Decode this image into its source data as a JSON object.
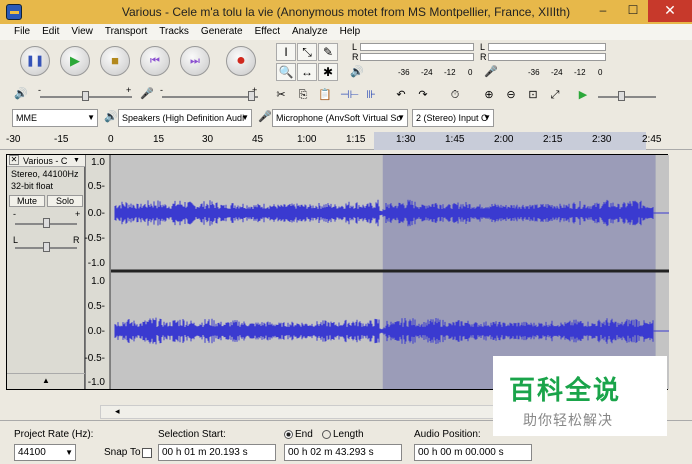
{
  "window": {
    "title": "Various - Cele m'a tolu la vie (Anonymous motet from MS Montpellier, France, XIIIth)",
    "min": "–",
    "max": "☐",
    "close": "✕"
  },
  "menu": [
    "File",
    "Edit",
    "View",
    "Transport",
    "Tracks",
    "Generate",
    "Effect",
    "Analyze",
    "Help"
  ],
  "transport": {
    "pause": "❚❚",
    "play": "▶",
    "stop": "■",
    "skip_start": "⏮",
    "skip_end": "⏭",
    "record": "●"
  },
  "tools": [
    "I",
    "⤡",
    "✎",
    "🔍",
    "↔",
    "✱"
  ],
  "meters": {
    "play_ticks": [
      "-36",
      "-24",
      "-12",
      "0"
    ],
    "rec_ticks": [
      "-36",
      "-24",
      "-12",
      "0"
    ],
    "L": "L",
    "R": "R"
  },
  "mixer": {
    "minus": "-",
    "plus": "+"
  },
  "devices": {
    "host": "MME",
    "output": "Speakers (High Definition Audi",
    "input": "Microphone (AnvSoft Virtual So",
    "channels": "2 (Stereo) Input C"
  },
  "timeline": {
    "ticks": [
      "-30",
      "-15",
      "0",
      "15",
      "30",
      "45",
      "1:00",
      "1:15",
      "1:30",
      "1:45",
      "2:00",
      "2:15",
      "2:30",
      "2:45"
    ]
  },
  "track": {
    "name": "Various - C",
    "close": "✕",
    "info1": "Stereo, 44100Hz",
    "info2": "32-bit float",
    "mute": "Mute",
    "solo": "Solo",
    "L": "L",
    "R": "R",
    "collapse": "▲",
    "scale": [
      "1.0",
      "0.5-",
      "0.0-",
      "-0.5-",
      "-1.0",
      "1.0",
      "0.5-",
      "0.0-",
      "-0.5-",
      "-1.0"
    ]
  },
  "colors": {
    "wave": "#3a3ad0",
    "wave_bg": "#c4c4c4",
    "wave_sel_bg": "#9b9cb8",
    "title_bg": "#e7b84a"
  },
  "selection": {
    "start_fraction": 0.487,
    "end_fraction": 0.976
  },
  "selectionbar": {
    "project_rate_label": "Project Rate (Hz):",
    "project_rate": "44100",
    "snap_to": "Snap To",
    "selection_start_label": "Selection Start:",
    "end_label": "End",
    "length_label": "Length",
    "audio_position_label": "Audio Position:",
    "start_value": "00 h 01 m 20.193 s",
    "end_value": "00 h 02 m 43.293 s",
    "position_value": "00 h 00 m 00.000 s"
  },
  "watermark": {
    "main": "百科全说",
    "sub": "助你轻松解决"
  }
}
